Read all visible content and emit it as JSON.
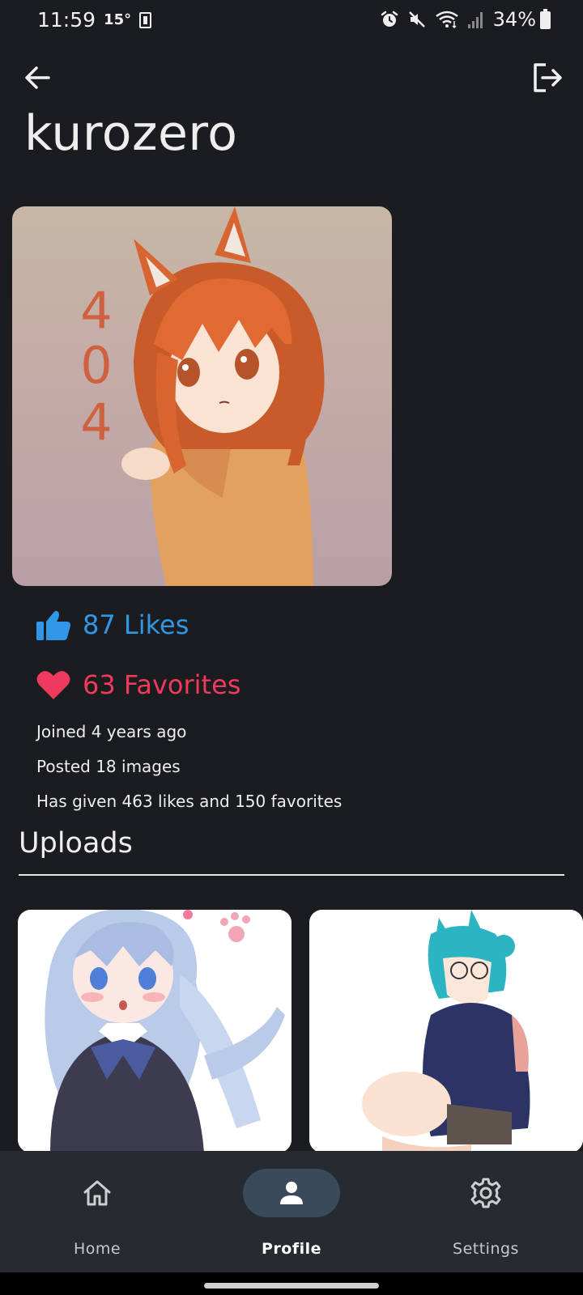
{
  "status_bar": {
    "time": "11:59",
    "temperature": "15°",
    "battery_percent": "34%",
    "icons": [
      "sim-card-icon",
      "alarm-icon",
      "mute-icon",
      "wifi-icon",
      "signal-icon",
      "battery-icon"
    ]
  },
  "header": {
    "back_icon": "arrow-left-icon",
    "logout_icon": "logout-icon",
    "username": "kurozero"
  },
  "avatar": {
    "overlay_text": [
      "4",
      "0",
      "4"
    ]
  },
  "stats": {
    "likes_label": "87 Likes",
    "favorites_label": "63 Favorites",
    "joined": "Joined 4 years ago",
    "posted": "Posted 18 images",
    "given": "Has given 463 likes and 150 favorites"
  },
  "uploads": {
    "title": "Uploads"
  },
  "nav": {
    "items": [
      {
        "label": "Home",
        "icon": "home-icon",
        "active": false
      },
      {
        "label": "Profile",
        "icon": "person-icon",
        "active": true
      },
      {
        "label": "Settings",
        "icon": "gear-icon",
        "active": false
      }
    ]
  },
  "colors": {
    "background": "#1b1c1f",
    "likes": "#2f97e6",
    "favorites": "#ee3a5c",
    "nav_background": "#262a31",
    "nav_active_pill": "#3b4a5b"
  }
}
